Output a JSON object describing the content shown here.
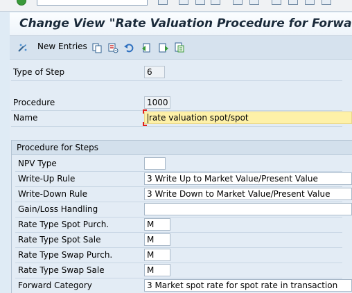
{
  "title": "Change View \"Rate Valuation Procedure for Forward Exc",
  "toolbar": {
    "new_entries_label": "New Entries",
    "icons": [
      "display-change-icon",
      "copy-icon",
      "delete-icon",
      "undo-icon",
      "previous-entry-icon",
      "next-entry-icon",
      "select-all-icon"
    ]
  },
  "header_fields": {
    "type_of_step": {
      "label": "Type of Step",
      "value": "6"
    },
    "procedure": {
      "label": "Procedure",
      "value": "1000"
    },
    "name": {
      "label": "Name",
      "value": "rate valuation spot/spot"
    }
  },
  "group": {
    "title": "Procedure for Steps",
    "fields": [
      {
        "label": "NPV Type",
        "value": ""
      },
      {
        "label": "Write-Up Rule",
        "value": "3 Write Up to Market Value/Present Value"
      },
      {
        "label": "Write-Down Rule",
        "value": "3 Write Down to Market Value/Present Value"
      },
      {
        "label": "Gain/Loss Handling",
        "value": ""
      },
      {
        "label": "Rate Type Spot Purch.",
        "value": "M"
      },
      {
        "label": "Rate Type Spot Sale",
        "value": "M"
      },
      {
        "label": "Rate Type Swap Purch.",
        "value": "M"
      },
      {
        "label": "Rate Type Swap Sale",
        "value": "M"
      },
      {
        "label": "Forward Category",
        "value": "3 Market spot rate for spot rate in transaction"
      }
    ]
  },
  "colors": {
    "background": "#dfebf5",
    "focus_field": "#fef1a8",
    "group_header": "#d3e0ec"
  }
}
